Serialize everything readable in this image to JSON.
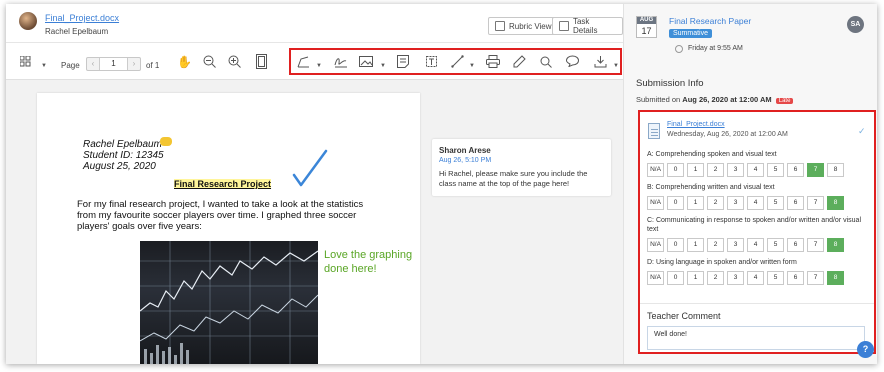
{
  "header": {
    "file_title": "Final_Project.docx",
    "student_name": "Rachel Epelbaum",
    "rubric_view_label": "Rubric View",
    "task_details_label": "Task Details"
  },
  "toolbar": {
    "page_label": "Page",
    "page_value": "1",
    "of_label": "of 1",
    "icons": [
      "thumbnails-icon",
      "hand-icon",
      "zoom-out-icon",
      "zoom-in-icon",
      "fit-page-icon",
      "pen-icon",
      "signature-icon",
      "image-icon",
      "note-icon",
      "text-box-icon",
      "line-icon",
      "print-icon",
      "edit-icon",
      "search-icon",
      "comment-icon",
      "download-icon"
    ]
  },
  "document": {
    "name_line": "Rachel Epelbaum",
    "id_line": "Student ID: 12345",
    "date_line": "August 25, 2020",
    "title": "Final Research Project",
    "paragraph": "For my final research project, I wanted to take a look at the statistics from my favourite soccer players over time. I graphed three soccer players' goals over five years:",
    "hand_note": "Love the graphing done here!"
  },
  "comment": {
    "author": "Sharon Arese",
    "date": "Aug 26, 5:10 PM",
    "text": "Hi Rachel, please make sure you include the class name at the top of the page here!"
  },
  "assignment": {
    "month": "AUG",
    "day": "17",
    "title": "Final Research Paper",
    "tag": "Summative",
    "due": "Friday at 9:55 AM",
    "teacher_initials": "SA"
  },
  "submission": {
    "section_title": "Submission Info",
    "submitted_prefix": "Submitted on",
    "submitted_date": "Aug 26, 2020 at 12:00 AM",
    "late_badge": "Late",
    "file_name": "Final_Project.docx",
    "file_date": "Wednesday, Aug 26, 2020 at 12:00 AM"
  },
  "rubric": {
    "options": [
      "N/A",
      "0",
      "1",
      "2",
      "3",
      "4",
      "5",
      "6",
      "7",
      "8"
    ],
    "criteria": [
      {
        "label": "A: Comprehending spoken and visual text",
        "selected": "7"
      },
      {
        "label": "B: Comprehending written and visual text",
        "selected": "8"
      },
      {
        "label": "C: Communicating in response to spoken and/or written and/or visual text",
        "selected": "8"
      },
      {
        "label": "D: Using language in spoken and/or written form",
        "selected": "8"
      }
    ]
  },
  "teacher_comment": {
    "label": "Teacher Comment",
    "value": "Well done!"
  },
  "colors": {
    "accent": "#3b7fd6",
    "selected_score": "#5cae5c",
    "highlight_box": "#e02020",
    "late": "#e54848"
  }
}
